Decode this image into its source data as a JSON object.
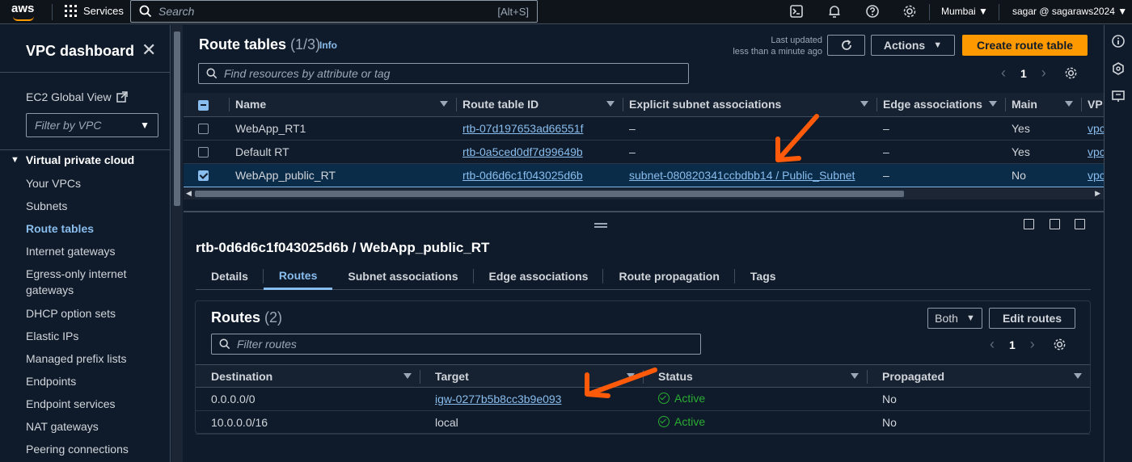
{
  "topbar": {
    "logo": "aws",
    "services": "Services",
    "search_placeholder": "Search",
    "search_shortcut": "[Alt+S]",
    "region": "Mumbai",
    "user": "sagar @ sagaraws2024"
  },
  "sidebar": {
    "title": "VPC dashboard",
    "ec2_global": "EC2 Global View",
    "filter_placeholder": "Filter by VPC",
    "section": "Virtual private cloud",
    "items": [
      "Your VPCs",
      "Subnets",
      "Route tables",
      "Internet gateways",
      "Egress-only internet gateways",
      "DHCP option sets",
      "Elastic IPs",
      "Managed prefix lists",
      "Endpoints",
      "Endpoint services",
      "NAT gateways",
      "Peering connections"
    ],
    "active_item": "Route tables"
  },
  "route_tables": {
    "title": "Route tables",
    "count": "(1/3)",
    "info": "Info",
    "last_updated_label": "Last updated",
    "last_updated_value": "less than a minute ago",
    "actions": "Actions",
    "create": "Create route table",
    "find_placeholder": "Find resources by attribute or tag",
    "page": "1",
    "columns": [
      "Name",
      "Route table ID",
      "Explicit subnet associations",
      "Edge associations",
      "Main",
      "VP"
    ],
    "rows": [
      {
        "name": "WebApp_RT1",
        "id": "rtb-07d197653ad66551f",
        "subnet": "–",
        "edge": "–",
        "main": "Yes",
        "vpc": "vpc",
        "selected": false
      },
      {
        "name": "Default RT",
        "id": "rtb-0a5ced0df7d99649b",
        "subnet": "–",
        "edge": "–",
        "main": "Yes",
        "vpc": "vpc",
        "selected": false
      },
      {
        "name": "WebApp_public_RT",
        "id": "rtb-0d6d6c1f043025d6b",
        "subnet": "subnet-080820341ccbdbb14 / Public_Subnet",
        "edge": "–",
        "main": "No",
        "vpc": "vpc",
        "selected": true
      }
    ]
  },
  "details": {
    "title": "rtb-0d6d6c1f043025d6b / WebApp_public_RT",
    "tabs": [
      "Details",
      "Routes",
      "Subnet associations",
      "Edge associations",
      "Route propagation",
      "Tags"
    ],
    "active_tab": "Routes"
  },
  "routes": {
    "title": "Routes",
    "count": "(2)",
    "both": "Both",
    "edit": "Edit routes",
    "filter_placeholder": "Filter routes",
    "page": "1",
    "columns": [
      "Destination",
      "Target",
      "Status",
      "Propagated"
    ],
    "rows": [
      {
        "destination": "0.0.0.0/0",
        "target": "igw-0277b5b8cc3b9e093",
        "target_link": true,
        "status": "Active",
        "propagated": "No"
      },
      {
        "destination": "10.0.0.0/16",
        "target": "local",
        "target_link": false,
        "status": "Active",
        "propagated": "No"
      }
    ]
  },
  "colors": {
    "accent": "#89bdee",
    "primary": "#ff9900",
    "success": "#29ad32",
    "annotation": "#ff5a0a"
  }
}
